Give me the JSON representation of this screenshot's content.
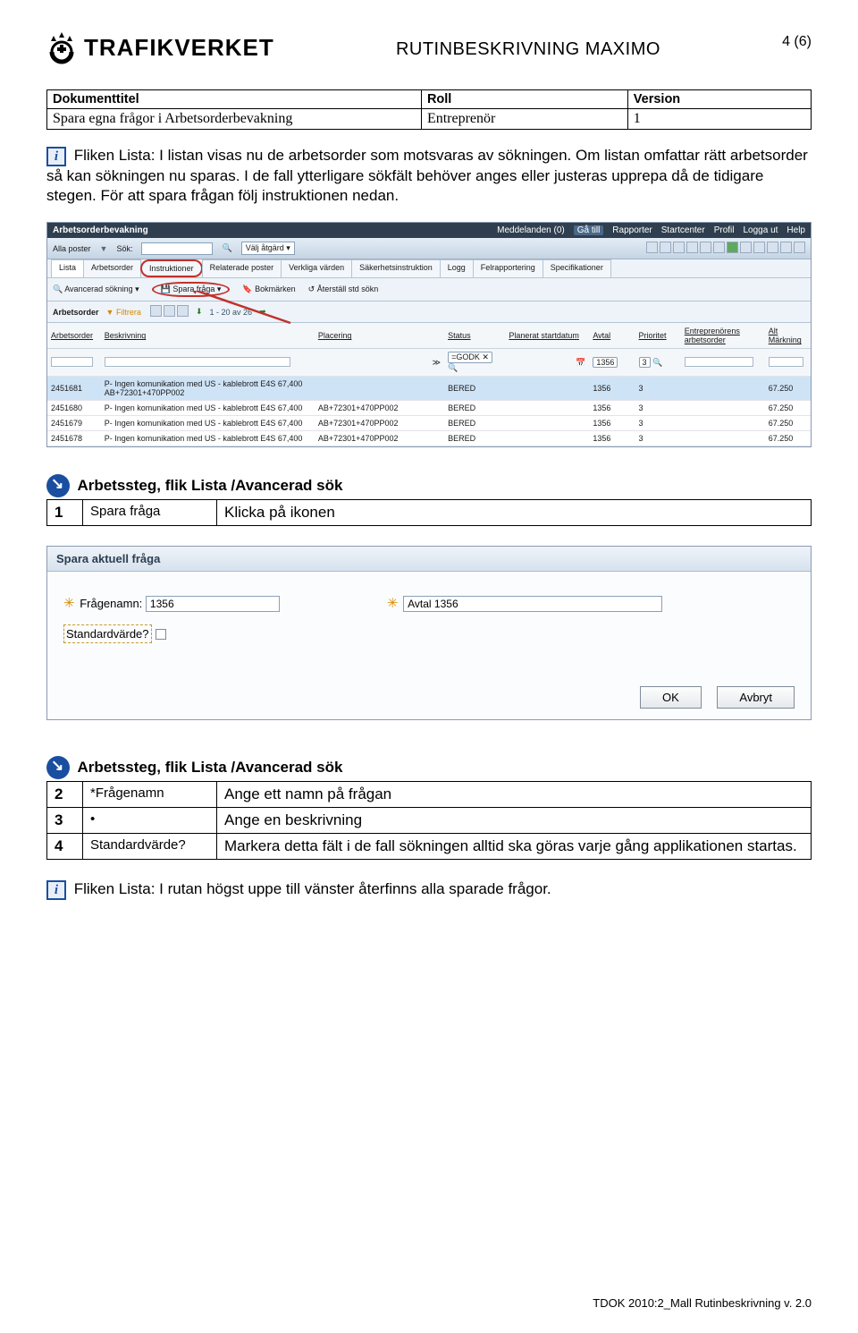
{
  "header": {
    "logo_text": "TRAFIKVERKET",
    "title": "RUTINBESKRIVNING MAXIMO",
    "page_num": "4 (6)"
  },
  "meta": {
    "h1": "Dokumenttitel",
    "h2": "Roll",
    "h3": "Version",
    "v1": "Spara egna frågor i Arbetsorderbevakning",
    "v2": "Entreprenör",
    "v3": "1"
  },
  "para1_lead": "Fliken Lista:",
  "para1_rest": " I listan visas nu de arbetsorder som motsvaras av sökningen. Om listan omfattar rätt arbetsorder så kan sökningen nu sparas. I de fall ytterligare sökfält behöver anges eller justeras upprepa då de tidigare stegen.  För att spara frågan följ instruktionen nedan.",
  "shot1": {
    "app": "Arbetsorderbevakning",
    "menu": [
      "Meddelanden  (0)",
      "Gå till",
      "Rapporter",
      "Startcenter",
      "Profil",
      "Logga ut",
      "Help"
    ],
    "poster": "Alla poster",
    "sok": "Sök:",
    "valj": "Välj åtgärd",
    "tabs": [
      "Lista",
      "Arbetsorder",
      "Instruktioner",
      "Relaterade poster",
      "Verkliga värden",
      "Säkerhetsinstruktion",
      "Logg",
      "Felrapportering",
      "Specifikationer"
    ],
    "adv": "Avancerad sökning",
    "spara": "Spara fråga",
    "bok": "Bokmärken",
    "aterstall": "Återställ std sökn",
    "filterlbl": "Arbetsorder",
    "filtrera": "Filtrera",
    "range": "1 - 20 av 26",
    "cols": [
      "Arbetsorder",
      "Beskrivning",
      "Placering",
      "Status",
      "Planerat startdatum",
      "Avtal",
      "Prioritet",
      "Entreprenörens arbetsorder",
      "Alt Märkning"
    ],
    "filter_status": "=GODK",
    "filter_avtal": "1356",
    "filter_prio": "3",
    "rows": [
      {
        "a": "2451681",
        "b": "P- Ingen komunikation med US - kablebrott E4S 67,400 AB+72301+470PP002",
        "p": "",
        "s": "BERED",
        "d": "",
        "av": "1356",
        "pr": "3",
        "e": "",
        "m": "67.250",
        "hl": true
      },
      {
        "a": "2451680",
        "b": "P- Ingen komunikation med US - kablebrott E4S 67,400",
        "p": "AB+72301+470PP002",
        "s": "BERED",
        "d": "",
        "av": "1356",
        "pr": "3",
        "e": "",
        "m": "67.250"
      },
      {
        "a": "2451679",
        "b": "P- Ingen komunikation med US - kablebrott E4S 67,400",
        "p": "AB+72301+470PP002",
        "s": "BERED",
        "d": "",
        "av": "1356",
        "pr": "3",
        "e": "",
        "m": "67.250"
      },
      {
        "a": "2451678",
        "b": "P- Ingen komunikation med US - kablebrott E4S 67,400",
        "p": "AB+72301+470PP002",
        "s": "BERED",
        "d": "",
        "av": "1356",
        "pr": "3",
        "e": "",
        "m": "67.250"
      }
    ]
  },
  "steps1_title": "Arbetssteg, flik Lista /Avancerad sök",
  "steps1": [
    {
      "n": "1",
      "l": "Spara fråga",
      "t": "Klicka på ikonen"
    }
  ],
  "shot2": {
    "title": "Spara aktuell fråga",
    "fragenamn_lbl": "Frågenamn:",
    "fragenamn_val": "1356",
    "avtal_lbl": "Avtal 1356",
    "std_lbl": "Standardvärde?",
    "ok": "OK",
    "cancel": "Avbryt"
  },
  "steps2_title": "Arbetssteg, flik Lista /Avancerad sök",
  "steps2": [
    {
      "n": "2",
      "l": "*Frågenamn",
      "t": "Ange ett namn på frågan"
    },
    {
      "n": "3",
      "l": "•",
      "t": "Ange en beskrivning"
    },
    {
      "n": "4",
      "l": "Standardvärde?",
      "t": "Markera detta fält i de fall sökningen alltid ska göras varje gång applikationen startas."
    }
  ],
  "para2_lead": "Fliken Lista:",
  "para2_rest": " I rutan högst uppe till vänster återfinns alla sparade frågor.",
  "footer": "TDOK 2010:2_Mall Rutinbeskrivning v. 2.0"
}
